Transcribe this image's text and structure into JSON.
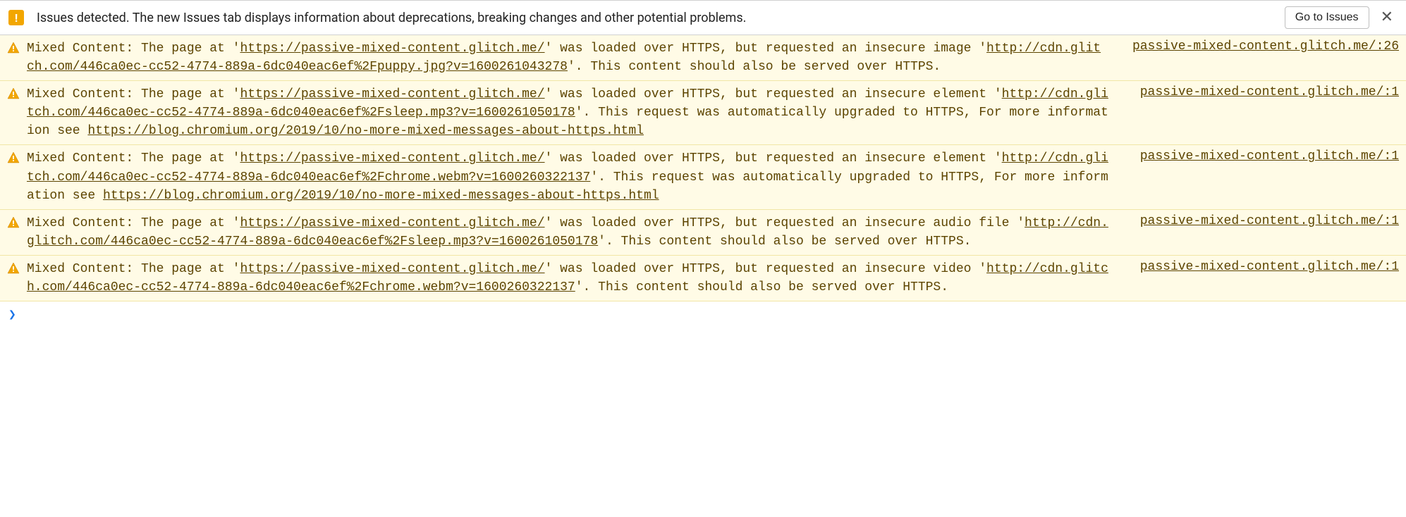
{
  "issues_bar": {
    "icon_glyph": "!",
    "text": "Issues detected. The new Issues tab displays information about deprecations, breaking changes and other potential problems.",
    "button_label": "Go to Issues",
    "close_glyph": "✕"
  },
  "warnings": [
    {
      "pre1": "Mixed Content: The page at '",
      "url1": "https://passive-mixed-content.glitch.me/",
      "mid1": "' was loaded over HTTPS, but requested an insecure image '",
      "url2": "http://cdn.glitch.com/446ca0ec-cc52-4774-889a-6dc040eac6ef%2Fpuppy.jpg?v=1600261043278",
      "tail": "'. This content should also be served over HTTPS.",
      "source": "passive-mixed-content.glitch.me/:26"
    },
    {
      "pre1": "Mixed Content: The page at '",
      "url1": "https://passive-mixed-content.glitch.me/",
      "mid1": "' was loaded over HTTPS, but requested an insecure element '",
      "url2": "http://cdn.glitch.com/446ca0ec-cc52-4774-889a-6dc040eac6ef%2Fsleep.mp3?v=1600261050178",
      "mid2": "'. This request was automatically upgraded to HTTPS, For more information see ",
      "url3": "https://blog.chromium.org/2019/10/no-more-mixed-messages-about-https.html",
      "tail": "",
      "source": "passive-mixed-content.glitch.me/:1"
    },
    {
      "pre1": "Mixed Content: The page at '",
      "url1": "https://passive-mixed-content.glitch.me/",
      "mid1": "' was loaded over HTTPS, but requested an insecure element '",
      "url2": "http://cdn.glitch.com/446ca0ec-cc52-4774-889a-6dc040eac6ef%2Fchrome.webm?v=1600260322137",
      "mid2": "'. This request was automatically upgraded to HTTPS, For more information see ",
      "url3": "https://blog.chromium.org/2019/10/no-more-mixed-messages-about-https.html",
      "tail": "",
      "source": "passive-mixed-content.glitch.me/:1"
    },
    {
      "pre1": "Mixed Content: The page at '",
      "url1": "https://passive-mixed-content.glitch.me/",
      "mid1": "' was loaded over HTTPS, but requested an insecure audio file '",
      "url2": "http://cdn.glitch.com/446ca0ec-cc52-4774-889a-6dc040eac6ef%2Fsleep.mp3?v=1600261050178",
      "tail": "'. This content should also be served over HTTPS.",
      "source": "passive-mixed-content.glitch.me/:1"
    },
    {
      "pre1": "Mixed Content: The page at '",
      "url1": "https://passive-mixed-content.glitch.me/",
      "mid1": "' was loaded over HTTPS, but requested an insecure video '",
      "url2": "http://cdn.glitch.com/446ca0ec-cc52-4774-889a-6dc040eac6ef%2Fchrome.webm?v=1600260322137",
      "tail": "'. This content should also be served over HTTPS.",
      "source": "passive-mixed-content.glitch.me/:1"
    }
  ]
}
